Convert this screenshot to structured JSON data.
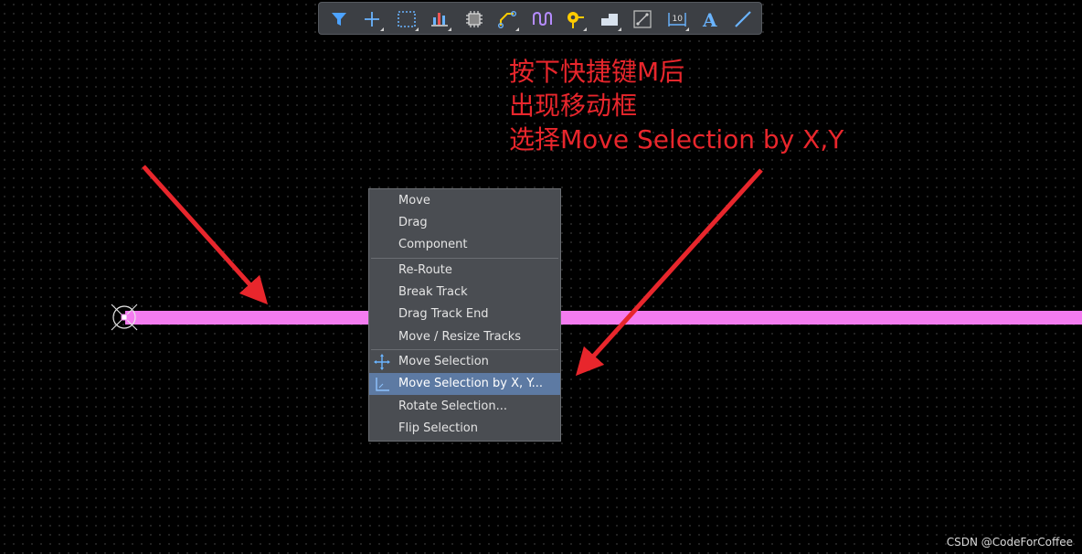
{
  "toolbar": {
    "items": [
      {
        "icon": "filter-icon"
      },
      {
        "icon": "crosshair-icon"
      },
      {
        "icon": "select-rect-icon"
      },
      {
        "icon": "bar-chart-icon"
      },
      {
        "icon": "component-chip-icon"
      },
      {
        "icon": "route-track-icon"
      },
      {
        "icon": "meander-icon"
      },
      {
        "icon": "via-pad-icon"
      },
      {
        "icon": "polygon-pour-icon"
      },
      {
        "icon": "keepout-icon"
      },
      {
        "icon": "dimension-icon"
      },
      {
        "icon": "text-icon",
        "glyph": "A"
      },
      {
        "icon": "line-icon"
      }
    ],
    "accent": "#ffcc00"
  },
  "annotation": {
    "line1": "按下快捷键M后",
    "line2": "出现移动框",
    "line3": "选择Move Selection by X,Y",
    "color": "#e8262c"
  },
  "track": {
    "color": "#f47cf0"
  },
  "context_menu": {
    "items": [
      {
        "label": "Move"
      },
      {
        "label": "Drag"
      },
      {
        "label": "Component"
      },
      {
        "label": "Re-Route"
      },
      {
        "label": "Break Track"
      },
      {
        "label": "Drag Track End"
      },
      {
        "label": "Move / Resize Tracks"
      },
      {
        "label": "Move Selection",
        "icon": "move-cross-icon"
      },
      {
        "label": "Move Selection by X, Y...",
        "icon": "xy-axes-icon",
        "highlighted": true
      },
      {
        "label": "Rotate Selection..."
      },
      {
        "label": "Flip Selection"
      }
    ],
    "highlight_color": "#5d7aa3"
  },
  "watermark": "CSDN @CodeForCoffee"
}
